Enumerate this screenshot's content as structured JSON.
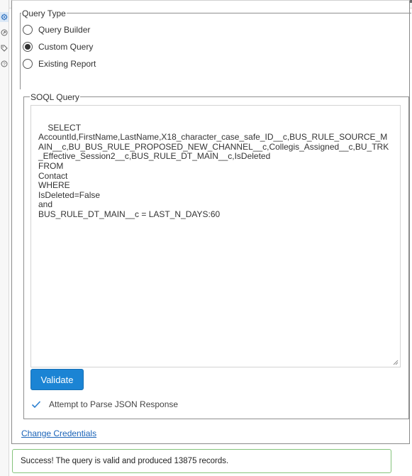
{
  "rail": {
    "icons": [
      "gear-icon",
      "info-circle-icon",
      "tag-icon",
      "help-icon"
    ],
    "active_index": 0
  },
  "query_type": {
    "legend": "Query Type",
    "options": [
      {
        "label": "Query Builder",
        "selected": false
      },
      {
        "label": "Custom Query",
        "selected": true
      },
      {
        "label": "Existing Report",
        "selected": false
      }
    ]
  },
  "soql": {
    "legend": "SOQL Query",
    "query": "SELECT\nAccountId,FirstName,LastName,X18_character_case_safe_ID__c,BUS_RULE_SOURCE_MAIN__c,BU_BUS_RULE_PROPOSED_NEW_CHANNEL__c,Collegis_Assigned__c,BU_TRK_Effective_Session2__c,BUS_RULE_DT_MAIN__c,IsDeleted\nFROM\nContact\nWHERE\nIsDeleted=False\nand\nBUS_RULE_DT_MAIN__c = LAST_N_DAYS:60"
  },
  "actions": {
    "validate_label": "Validate",
    "parse_json_label": "Attempt to Parse JSON Response",
    "parse_json_checked": true,
    "change_credentials_label": "Change Credentials"
  },
  "status": {
    "message": "Success! The query is valid and produced 13875 records.",
    "color": "#84c37b"
  },
  "colors": {
    "accent": "#1b84d4",
    "link": "#1a63b8",
    "success_border": "#84c37b"
  }
}
